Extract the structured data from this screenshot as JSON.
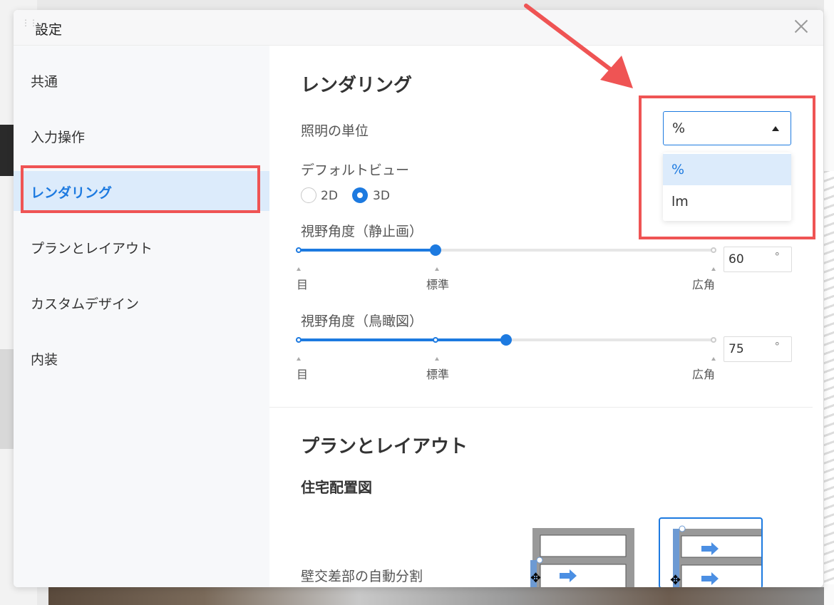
{
  "dialog": {
    "title": "設定",
    "close_icon": "close-icon"
  },
  "sidebar": {
    "items": [
      {
        "label": "共通"
      },
      {
        "label": "入力操作"
      },
      {
        "label": "レンダリング",
        "active": true
      },
      {
        "label": "プランとレイアウト"
      },
      {
        "label": "カスタムデザイン"
      },
      {
        "label": "内装"
      }
    ]
  },
  "rendering": {
    "heading": "レンダリング",
    "lighting_unit": {
      "label": "照明の単位",
      "value": "%",
      "options": [
        "%",
        "lm"
      ]
    },
    "default_view": {
      "label": "デフォルトビュー",
      "options": [
        "2D",
        "3D"
      ],
      "selected": "3D"
    },
    "fov_still": {
      "label": "視野角度（静止画）",
      "ticks": [
        "目",
        "標準",
        "広角"
      ],
      "value": "60",
      "unit": "°",
      "level": 0.33
    },
    "fov_birdseye": {
      "label": "視野角度（鳥瞰図）",
      "ticks": [
        "目",
        "標準",
        "広角"
      ],
      "value": "75",
      "unit": "°",
      "level": 0.5
    }
  },
  "plan_layout": {
    "heading": "プランとレイアウト",
    "subheading": "住宅配置図",
    "auto_split_label": "壁交差部の自動分割"
  },
  "colors": {
    "accent": "#1d7ae0",
    "highlight": "#ef5454",
    "selected_bg": "#dcebfb"
  }
}
